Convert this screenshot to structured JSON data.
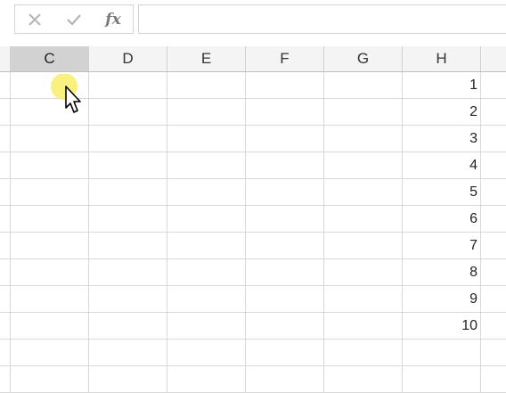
{
  "formula_bar": {
    "cancel_icon": "x-icon",
    "enter_icon": "check-icon",
    "function_label": "fx",
    "formula_value": ""
  },
  "columns": [
    "C",
    "D",
    "E",
    "F",
    "G",
    "H"
  ],
  "selected_column": "C",
  "rows": [
    {
      "C": "",
      "D": "",
      "E": "",
      "F": "",
      "G": "",
      "H": "1"
    },
    {
      "C": "",
      "D": "",
      "E": "",
      "F": "",
      "G": "",
      "H": "2"
    },
    {
      "C": "",
      "D": "",
      "E": "",
      "F": "",
      "G": "",
      "H": "3"
    },
    {
      "C": "",
      "D": "",
      "E": "",
      "F": "",
      "G": "",
      "H": "4"
    },
    {
      "C": "",
      "D": "",
      "E": "",
      "F": "",
      "G": "",
      "H": "5"
    },
    {
      "C": "",
      "D": "",
      "E": "",
      "F": "",
      "G": "",
      "H": "6"
    },
    {
      "C": "",
      "D": "",
      "E": "",
      "F": "",
      "G": "",
      "H": "7"
    },
    {
      "C": "",
      "D": "",
      "E": "",
      "F": "",
      "G": "",
      "H": "8"
    },
    {
      "C": "",
      "D": "",
      "E": "",
      "F": "",
      "G": "",
      "H": "9"
    },
    {
      "C": "",
      "D": "",
      "E": "",
      "F": "",
      "G": "",
      "H": "10"
    },
    {
      "C": "",
      "D": "",
      "E": "",
      "F": "",
      "G": "",
      "H": ""
    },
    {
      "C": "",
      "D": "",
      "E": "",
      "F": "",
      "G": "",
      "H": ""
    }
  ],
  "colors": {
    "selected_header": "#d2d2d2",
    "gridline": "#d9d9d9",
    "cursor_highlight": "#f7ef6a"
  }
}
